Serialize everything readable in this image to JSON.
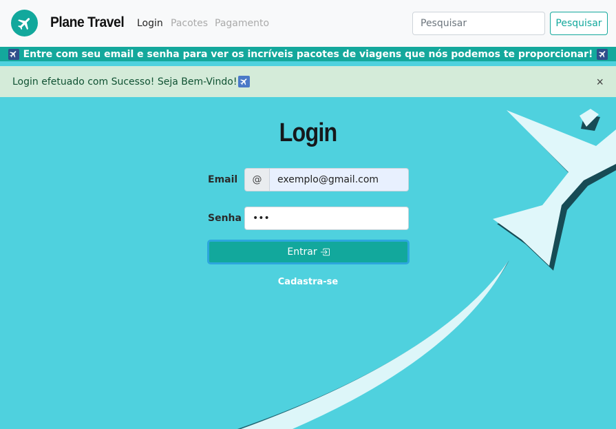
{
  "navbar": {
    "brand": "Plane Travel",
    "links": [
      "Login",
      "Pacotes",
      "Pagamento"
    ],
    "search_placeholder": "Pesquisar",
    "search_button": "Pesquisar"
  },
  "banner": {
    "text": "Entre com seu email e senha para ver os incríveis pacotes de viagens que nós podemos te proporcionar!"
  },
  "alert": {
    "text": "Login efetuado com Sucesso! Seja Bem-Vindo!",
    "close": "×"
  },
  "login": {
    "title": "Login",
    "email_label": "Email",
    "email_addon": "@",
    "email_value": "exemplo@gmail.com",
    "password_label": "Senha",
    "password_value": "•••",
    "submit_label": "Entrar",
    "register_link": "Cadastra-se"
  },
  "colors": {
    "accent": "#12a89c",
    "background": "#4fd1de",
    "alert_bg": "#d4ebd9"
  },
  "icons": [
    "airplane-icon",
    "sign-in-icon",
    "close-icon"
  ]
}
